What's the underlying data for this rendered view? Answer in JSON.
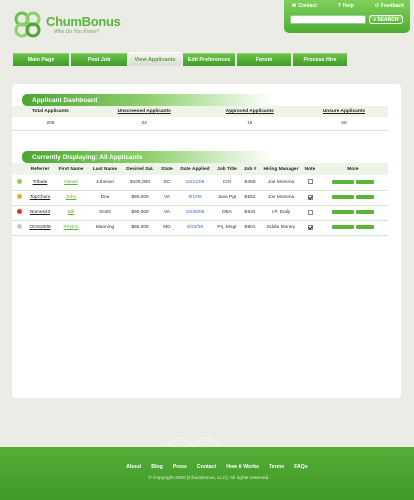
{
  "brand": {
    "title_a": "Chum",
    "title_b": "Bonus",
    "tagline": "Who Do You Know?"
  },
  "top": {
    "contact": "Contact",
    "help": "Help",
    "feedback": "Feedback",
    "search_placeholder": "",
    "search_label": "SEARCH"
  },
  "nav": [
    "Main Page",
    "Post Job",
    "View Applicants",
    "Edit Preferences",
    "Forum",
    "Process Hire"
  ],
  "dashboard": {
    "title": "Applicant Dashboard",
    "headers": [
      "Total Applicants",
      "Unscreened Applicants",
      "Approved Applicants",
      "Unsure Applicants"
    ],
    "values": [
      "205",
      "23",
      "15",
      "25"
    ]
  },
  "applicants": {
    "title": "Currently Displaying: All Applicants",
    "headers": [
      "Referrer",
      "First Name",
      "Last Name",
      "Desired Sal.",
      "State",
      "Date Applied",
      "Job Title",
      "Job #",
      "Hiring Manager",
      "Note",
      "More"
    ],
    "rows": [
      {
        "status": "#8fcf5c",
        "referrer": "Tribute",
        "first": "Daniel",
        "last": "Johnson",
        "salary": "$105,000",
        "state": "DC",
        "date": "10/21/08",
        "job": "CIO",
        "jobno": "B459",
        "manager": "Joe Momma",
        "note": false
      },
      {
        "status": "#f2a33a",
        "referrer": "TopChum",
        "first": "John",
        "last": "Doe",
        "salary": "$85,000",
        "state": "VA",
        "date": "9/1/08",
        "job": "Java Pgr",
        "jobno": "B552",
        "manager": "Joe Momma",
        "note": true
      },
      {
        "status": "#d9332b",
        "referrer": "Nomes23",
        "first": "Bill",
        "last": "Smith",
        "salary": "$90,000",
        "state": "VA",
        "date": "10/30/08",
        "job": "DBA",
        "jobno": "B534",
        "manager": "I.P. Daily",
        "note": false
      },
      {
        "status": "#cccccc",
        "referrer": "OOS2008",
        "first": "Peyton",
        "last": "Manning",
        "salary": "$55,000",
        "state": "MD",
        "date": "8/23/08",
        "job": "Prj. Mngr",
        "jobno": "B601",
        "manager": "Eddie Money",
        "note": true
      }
    ]
  },
  "footer": {
    "links": [
      "About",
      "Blog",
      "Press",
      "Contact",
      "How it Works",
      "Terms",
      "FAQs"
    ],
    "copyright": "© Copyright 2008 [ChumBonus, LLC]. All rights reserved."
  },
  "colors": {
    "brand_green": "#5ab53a",
    "date_blue": "#3a66c4"
  }
}
